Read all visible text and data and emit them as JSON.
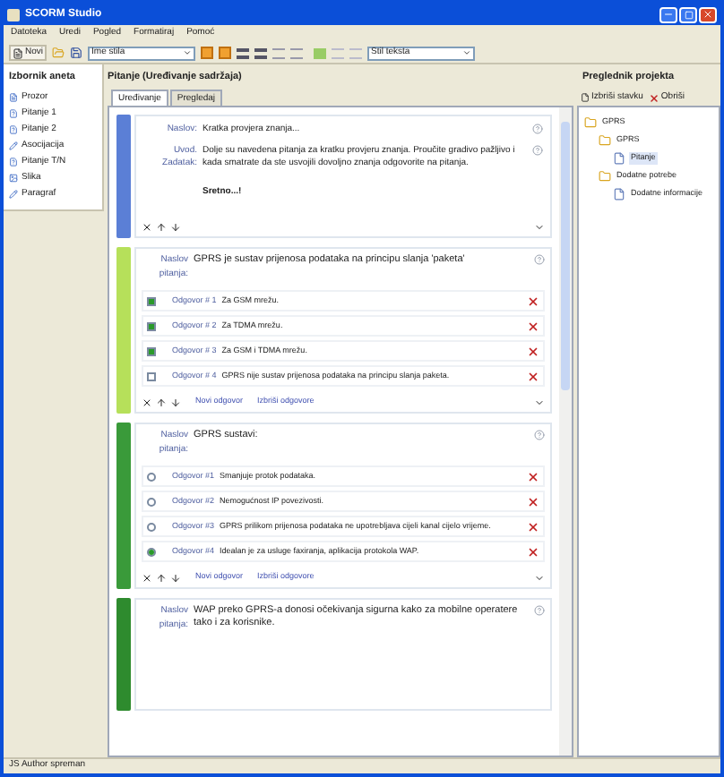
{
  "window": {
    "title": "SCORM Studio"
  },
  "menu": [
    "Datoteka",
    "Uredi",
    "Pogled",
    "Formatiraj",
    "Pomoć"
  ],
  "toolbar": {
    "new_label": "Novi",
    "style_select": "Ime stila",
    "text_select": "Stil teksta",
    "bold_on": true,
    "italic_on": true
  },
  "sidebar": {
    "title": "Izbornik aneta",
    "items": [
      "Prozor",
      "Pitanje 1",
      "Pitanje 2",
      "Asocijacija",
      "Pitanje T/N",
      "Slika",
      "Paragraf"
    ]
  },
  "editor": {
    "title": "Pitanje (Uređivanje sadržaja)",
    "tabs": [
      {
        "label": "Uređivanje",
        "selected": true
      },
      {
        "label": "Pregledaj",
        "selected": false
      }
    ],
    "cards": [
      {
        "kind": "intro",
        "color": "#5b7fd6",
        "fields": [
          {
            "label": "Naslov:",
            "text": "Kratka provjera znanja..."
          },
          {
            "label": "Uvod. Zadatak:",
            "text": "Dolje su navedena pitanja za kratku provjeru znanja. Proučite gradivo pažljivo i kada smatrate da ste usvojili dovoljno znanja odgovorite na pitanja."
          }
        ],
        "closing": "Sretno...!"
      },
      {
        "kind": "checkbox",
        "color": "#b6e05a",
        "question_label": "Naslov pitanja:",
        "question": "GPRS je sustav prijenosa podataka na principu slanja 'paketa'",
        "answers": [
          {
            "label": "Odgovor # 1",
            "text": "Za GSM mrežu.",
            "checked": true
          },
          {
            "label": "Odgovor # 2",
            "text": "Za TDMA mrežu.",
            "checked": true
          },
          {
            "label": "Odgovor # 3",
            "text": "Za GSM i TDMA mrežu.",
            "checked": true
          },
          {
            "label": "Odgovor # 4",
            "text": "GPRS nije sustav prijenosa podataka na principu slanja paketa.",
            "checked": false
          }
        ],
        "links": [
          "Novi odgovor",
          "Izbriši odgovore"
        ]
      },
      {
        "kind": "radio",
        "color": "#3a9a3a",
        "question_label": "Naslov pitanja:",
        "question": "GPRS sustavi:",
        "answers": [
          {
            "label": "Odgovor #1",
            "text": "Smanjuje protok podataka.",
            "selected": false
          },
          {
            "label": "Odgovor #2",
            "text": "Nemogućnost IP povezivosti.",
            "selected": false
          },
          {
            "label": "Odgovor #3",
            "text": "GPRS prilikom prijenosa podataka ne upotrebljava cijeli kanal cijelo vrijeme.",
            "selected": false
          },
          {
            "label": "Odgovor #4",
            "text": "Idealan je za usluge faxiranja, aplikacija protokola WAP.",
            "selected": true
          }
        ],
        "links": [
          "Novi odgovor",
          "Izbriši odgovore"
        ]
      },
      {
        "kind": "truefalse",
        "color": "#2e8b2e",
        "question_label": "Naslov pitanja:",
        "question": "WAP preko GPRS-a donosi očekivanja sigurna kako za mobilne operatere tako i za korisnike."
      }
    ]
  },
  "project": {
    "title": "Preglednik projekta",
    "actions": [
      "Izbriši stavku",
      "Obriši"
    ],
    "tree": [
      {
        "label": "GPRS",
        "children": [
          {
            "label": "GPRS",
            "children": [
              {
                "label": "Pitanje",
                "selected": true
              }
            ]
          },
          {
            "label": "Dodatne potrebe",
            "children": [
              {
                "label": "Dodatne informacije",
                "selected": false
              }
            ]
          }
        ]
      }
    ]
  },
  "status_bar": "JS Author spreman"
}
